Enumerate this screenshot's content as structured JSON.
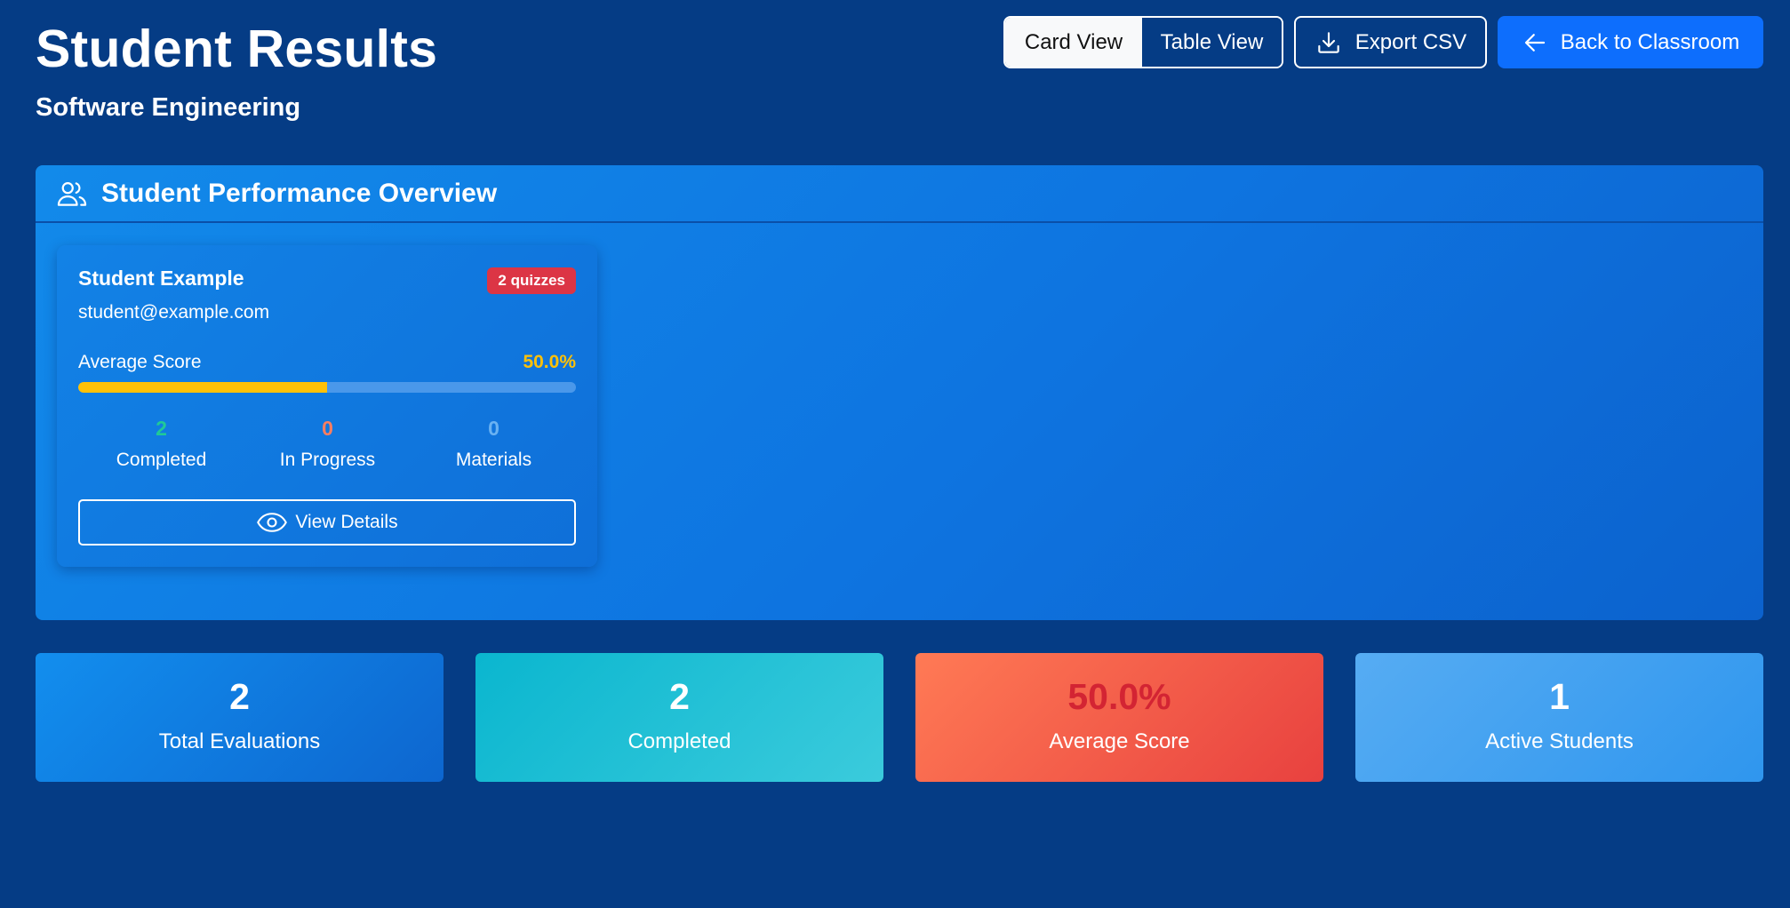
{
  "header": {
    "title": "Student Results",
    "subtitle": "Software Engineering"
  },
  "toolbar": {
    "view_toggle": {
      "selected": "Card View",
      "card_view_label": "Card View",
      "table_view_label": "Table View"
    },
    "export_label": "Export CSV",
    "back_label": "Back to Classroom",
    "export_icon": "download-icon",
    "back_icon": "arrow-left-icon"
  },
  "overview": {
    "title": "Student Performance Overview",
    "icon": "users-icon",
    "students": [
      {
        "name": "Student Example",
        "email": "student@example.com",
        "badge": "2 quizzes",
        "average_label": "Average Score",
        "average_value": "50.0%",
        "average_fraction": 0.5,
        "stats": [
          {
            "value": "2",
            "label": "Completed",
            "color": "#20c997"
          },
          {
            "value": "0",
            "label": "In Progress",
            "color": "#fd7e60"
          },
          {
            "value": "0",
            "label": "Materials",
            "color": "#6ab2f2"
          }
        ],
        "view_details_label": "View Details",
        "view_details_icon": "eye-icon"
      }
    ]
  },
  "summary": [
    {
      "value": "2",
      "label": "Total Evaluations"
    },
    {
      "value": "2",
      "label": "Completed"
    },
    {
      "value": "50.0%",
      "label": "Average Score"
    },
    {
      "value": "1",
      "label": "Active Students"
    }
  ],
  "colors": {
    "background": "#053c85",
    "primary": "#0d6efd",
    "badge": "#dc3545",
    "warning": "#ffc107"
  }
}
